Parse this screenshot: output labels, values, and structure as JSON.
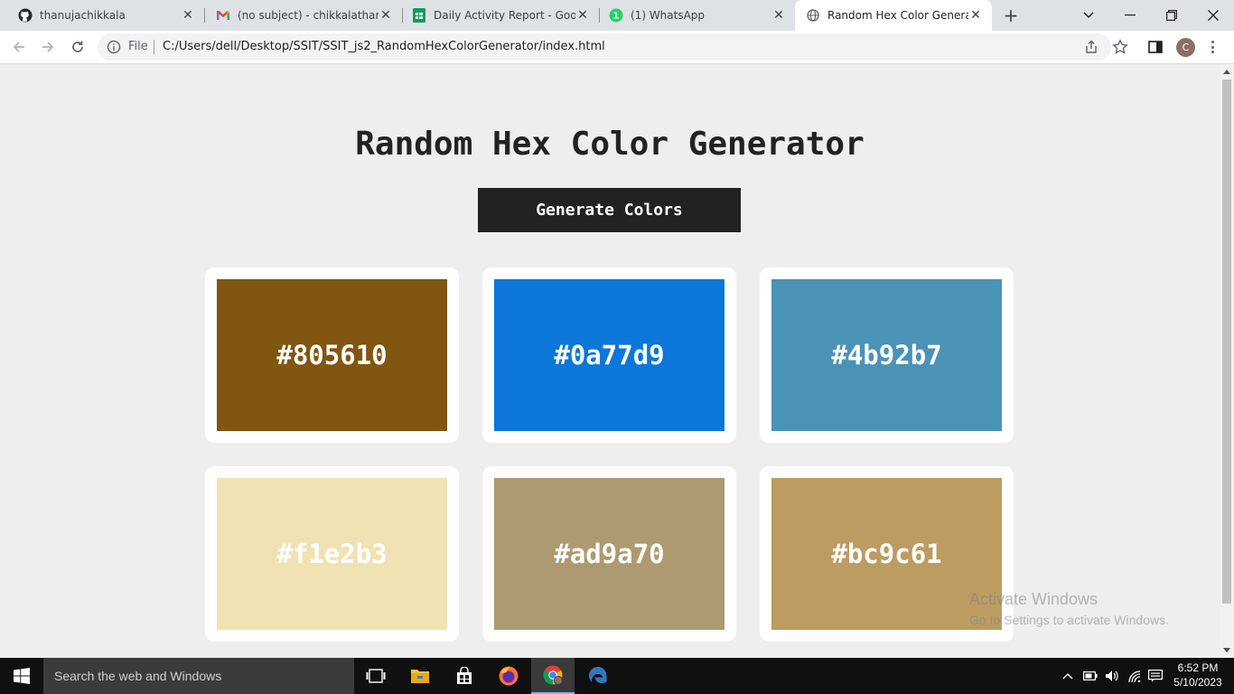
{
  "browser": {
    "tabs": [
      {
        "title": "thanujachikkala",
        "icon": "github-icon"
      },
      {
        "title": "(no subject) - chikkalathanuja",
        "icon": "gmail-icon"
      },
      {
        "title": "Daily Activity Report - Google",
        "icon": "sheets-icon"
      },
      {
        "title": "(1) WhatsApp",
        "icon": "whatsapp-icon"
      },
      {
        "title": "Random Hex Color Generator",
        "icon": "globe-icon"
      }
    ],
    "active_tab": 4,
    "omnibox": {
      "scheme_label": "File",
      "url": "C:/Users/dell/Desktop/SSIT/SSIT_js2_RandomHexColorGenerator/index.html"
    },
    "profile_initial": "C"
  },
  "page": {
    "title": "Random Hex Color Generator",
    "button_label": "Generate Colors",
    "colors": [
      {
        "hex": "#805610"
      },
      {
        "hex": "#0a77d9"
      },
      {
        "hex": "#4b92b7"
      },
      {
        "hex": "#f1e2b3"
      },
      {
        "hex": "#ad9a70"
      },
      {
        "hex": "#bc9c61"
      }
    ]
  },
  "watermark": {
    "line1": "Activate Windows",
    "line2": "Go to Settings to activate Windows."
  },
  "taskbar": {
    "search_placeholder": "Search the web and Windows",
    "time": "6:52 PM",
    "date": "5/10/2023"
  }
}
